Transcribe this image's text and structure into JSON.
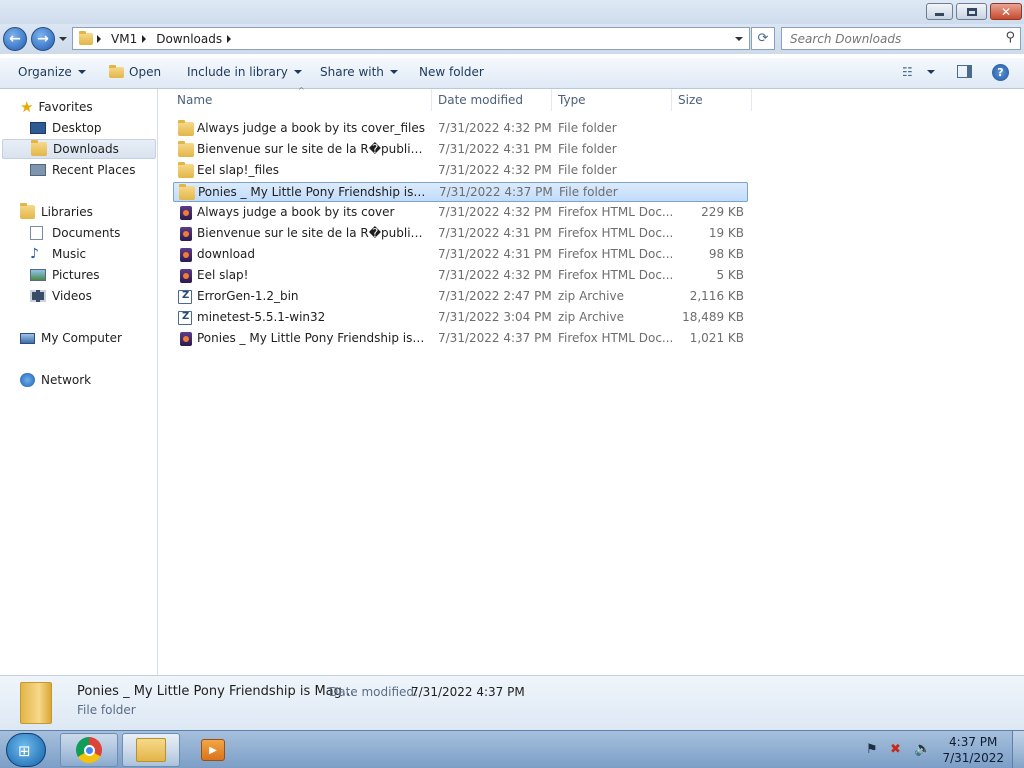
{
  "window": {
    "title": ""
  },
  "address": {
    "crumbs": [
      "VM1",
      "Downloads"
    ]
  },
  "search": {
    "placeholder": "Search Downloads"
  },
  "toolbar": {
    "organize": "Organize",
    "open": "Open",
    "include_in_library": "Include in library",
    "share_with": "Share with",
    "new_folder": "New folder"
  },
  "sidebar": {
    "favorites": "Favorites",
    "desktop": "Desktop",
    "downloads": "Downloads",
    "recent_places": "Recent Places",
    "libraries": "Libraries",
    "documents": "Documents",
    "music": "Music",
    "pictures": "Pictures",
    "videos": "Videos",
    "my_computer": "My Computer",
    "network": "Network",
    "selected": "Downloads"
  },
  "columns": {
    "name": "Name",
    "date": "Date modified",
    "type": "Type",
    "size": "Size"
  },
  "files": [
    {
      "name": "Always judge a book by its cover_files",
      "date": "7/31/2022 4:32 PM",
      "type": "File folder",
      "size": "",
      "icon": "folder-icon"
    },
    {
      "name": "Bienvenue sur le site de la R�publique d...",
      "date": "7/31/2022 4:31 PM",
      "type": "File folder",
      "size": "",
      "icon": "folder-icon"
    },
    {
      "name": "Eel slap!_files",
      "date": "7/31/2022 4:32 PM",
      "type": "File folder",
      "size": "",
      "icon": "folder-icon"
    },
    {
      "name": "Ponies _ My Little Pony Friendship is Ma...",
      "date": "7/31/2022 4:37 PM",
      "type": "File folder",
      "size": "",
      "icon": "folder-icon",
      "selected": true
    },
    {
      "name": "Always judge a book by its cover",
      "date": "7/31/2022 4:32 PM",
      "type": "Firefox HTML Doc...",
      "size": "229 KB",
      "icon": "firefox-html-icon"
    },
    {
      "name": "Bienvenue sur le site de la R�publique d...",
      "date": "7/31/2022 4:31 PM",
      "type": "Firefox HTML Doc...",
      "size": "19 KB",
      "icon": "firefox-html-icon"
    },
    {
      "name": "download",
      "date": "7/31/2022 4:31 PM",
      "type": "Firefox HTML Doc...",
      "size": "98 KB",
      "icon": "firefox-html-icon"
    },
    {
      "name": "Eel slap!",
      "date": "7/31/2022 4:32 PM",
      "type": "Firefox HTML Doc...",
      "size": "5 KB",
      "icon": "firefox-html-icon"
    },
    {
      "name": "ErrorGen-1.2_bin",
      "date": "7/31/2022 2:47 PM",
      "type": "zip Archive",
      "size": "2,116 KB",
      "icon": "zip-icon"
    },
    {
      "name": "minetest-5.5.1-win32",
      "date": "7/31/2022 3:04 PM",
      "type": "zip Archive",
      "size": "18,489 KB",
      "icon": "zip-icon"
    },
    {
      "name": "Ponies _ My Little Pony Friendship is Ma...",
      "date": "7/31/2022 4:37 PM",
      "type": "Firefox HTML Doc...",
      "size": "1,021 KB",
      "icon": "firefox-html-icon"
    }
  ],
  "details": {
    "name": "Ponies _ My Little Pony Friendship is Mag...",
    "date_label": "Date modified:",
    "date_value": "7/31/2022 4:37 PM",
    "type": "File folder"
  },
  "taskbar": {
    "apps": [
      "chrome-icon",
      "explorer-icon",
      "media-player-icon"
    ],
    "time": "4:37 PM",
    "date": "7/31/2022"
  },
  "colors": {
    "selection": "#cce4fc",
    "selection_border": "#7da2ce",
    "taskbar": "#8fb0d4"
  }
}
